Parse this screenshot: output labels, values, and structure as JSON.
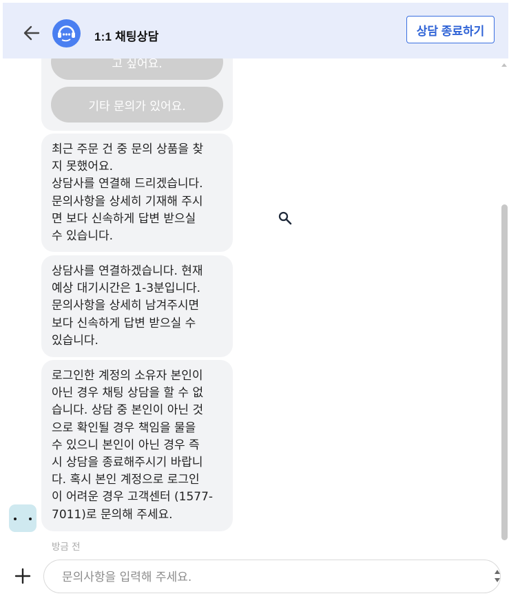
{
  "header": {
    "title": "1:1 채팅상담",
    "end_button": "상담 종료하기",
    "back_icon": "arrow-left-icon",
    "avatar_icon": "headset-agent-icon"
  },
  "chat": {
    "options": [
      {
        "label": "고 싶어요."
      },
      {
        "label": "기타 문의가 있어요."
      }
    ],
    "messages": [
      {
        "text": "최근 주문 건 중 문의 상품을 찾\n지 못했어요.\n상담사를 연결해 드리겠습니다.\n문의사항을 상세히 기재해 주시\n면 보다 신속하게 답변 받으실\n수 있습니다."
      },
      {
        "text": "상담사를 연결하겠습니다. 현재\n예상 대기시간은 1-3분입니다.\n문의사항을 상세히 남겨주시면\n보다 신속하게 답변 받으실 수\n있습니다."
      },
      {
        "text": "로그인한 계정의 소유자 본인이\n아닌 경우 채팅 상담을 할 수 없\n습니다. 상담 중 본인이 아닌 것\n으로 확인될 경우 책임을 물을\n수 있으니 본인이 아닌 경우 즉\n시 상담을 종료해주시기 바랍니\n다. 혹시 본인 계정으로 로그인\n이 어려운 경우 고객센터 (1577-\n7011)로 문의해 주세요."
      }
    ],
    "timestamp": "방금 전"
  },
  "input": {
    "placeholder": "문의사항을 입력해 주세요.",
    "value": ""
  },
  "colors": {
    "header_bg": "#e8edfb",
    "accent": "#2f63d6",
    "bubble_bg": "#f2f3f5",
    "option_bg": "#cfcfcf",
    "bot_icon_bg": "#cfe9f0"
  }
}
